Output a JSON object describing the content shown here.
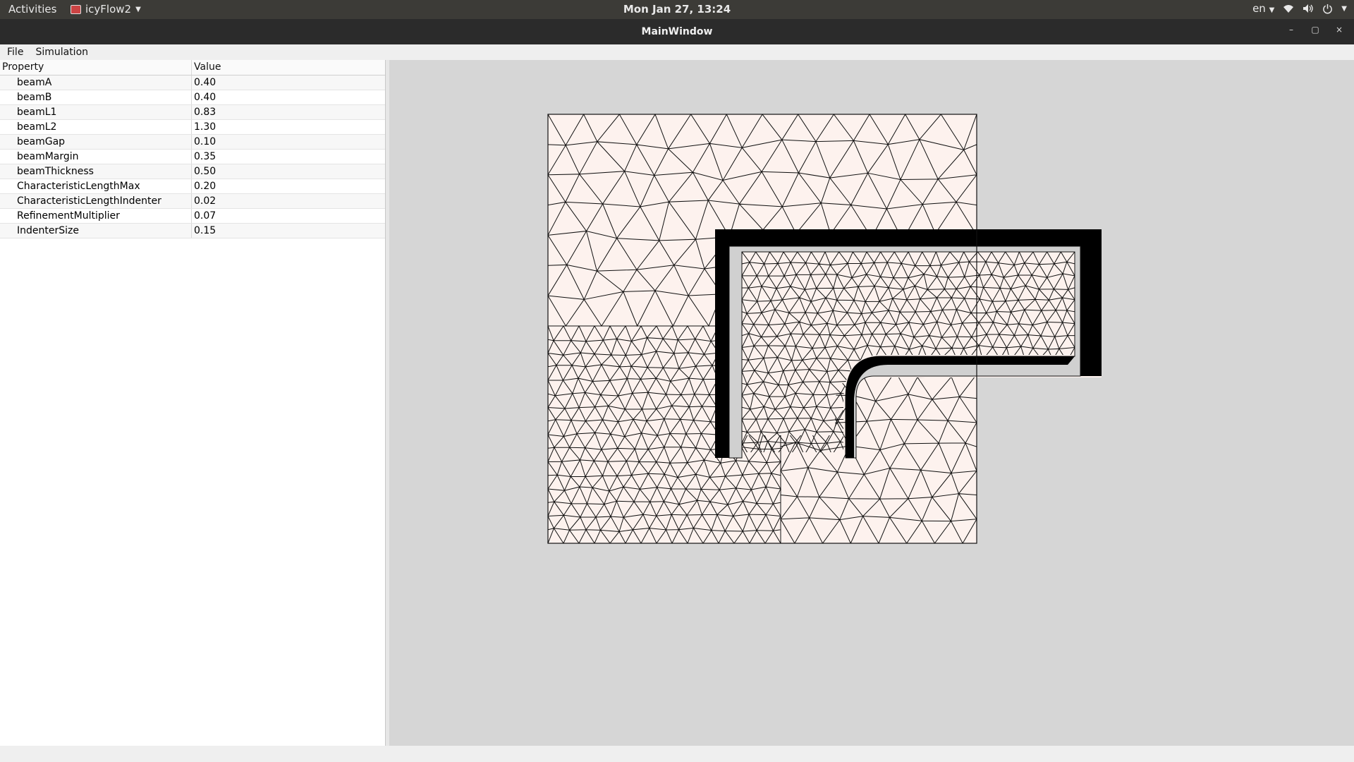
{
  "topbar": {
    "activities": "Activities",
    "app_name": "icyFlow2",
    "clock": "Mon Jan 27, 13:24",
    "lang": "en",
    "icons": [
      "wifi-icon",
      "volume-icon",
      "power-icon"
    ]
  },
  "window": {
    "title": "MainWindow",
    "buttons": [
      "minimize",
      "maximize",
      "close"
    ]
  },
  "menu": {
    "file": "File",
    "simulation": "Simulation"
  },
  "properties": {
    "header_property": "Property",
    "header_value": "Value",
    "rows": [
      {
        "name": "beamA",
        "value": "0.40"
      },
      {
        "name": "beamB",
        "value": "0.40"
      },
      {
        "name": "beamL1",
        "value": "0.83"
      },
      {
        "name": "beamL2",
        "value": "1.30"
      },
      {
        "name": "beamGap",
        "value": "0.10"
      },
      {
        "name": "beamMargin",
        "value": "0.35"
      },
      {
        "name": "beamThickness",
        "value": "0.50"
      },
      {
        "name": "CharacteristicLengthMax",
        "value": "0.20"
      },
      {
        "name": "CharacteristicLengthIndenter",
        "value": "0.02"
      },
      {
        "name": "RefinementMultiplier",
        "value": "0.07"
      },
      {
        "name": "IndenterSize",
        "value": "0.15"
      }
    ]
  },
  "colors": {
    "mesh_fill": "#fdf2ee",
    "beam_fill": "#d0d0d0",
    "mesh_line": "#111111",
    "canvas_bg": "#d6d6d6"
  }
}
